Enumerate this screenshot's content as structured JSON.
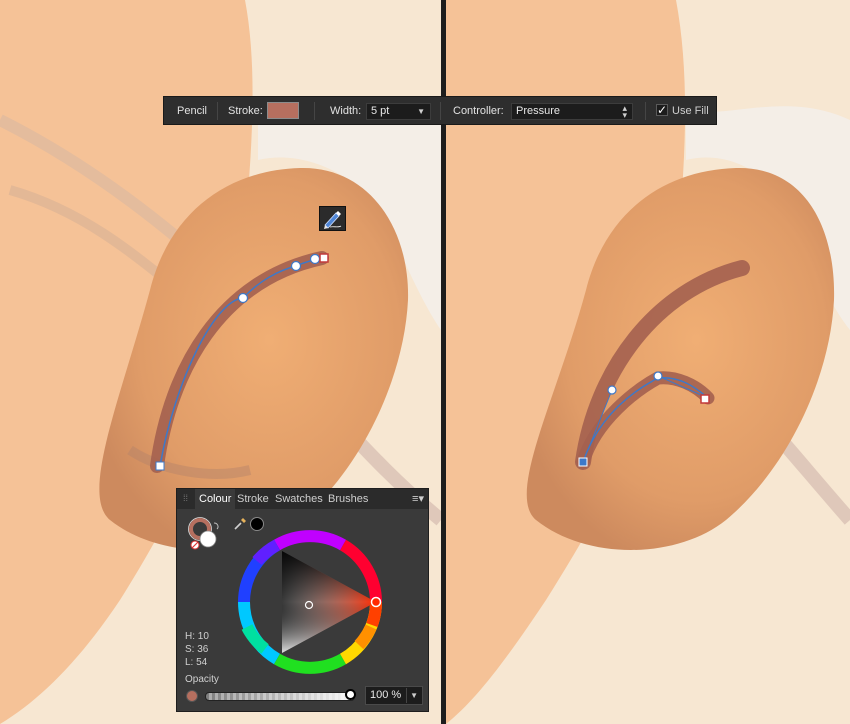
{
  "toolbar": {
    "tool_name": "Pencil",
    "stroke_label": "Stroke:",
    "stroke_color": "#b66f5f",
    "width_label": "Width:",
    "width_value": "5 pt",
    "controller_label": "Controller:",
    "controller_value": "Pressure",
    "use_fill_label": "Use Fill",
    "use_fill_checked": true
  },
  "colour_panel": {
    "tabs": [
      "Colour",
      "Stroke",
      "Swatches",
      "Brushes"
    ],
    "active_tab": "Colour",
    "hsl": {
      "h": "H: 10",
      "s": "S: 36",
      "l": "L: 54"
    },
    "opacity_label": "Opacity",
    "opacity_value": "100 %",
    "opacity_fraction": 1.0
  },
  "colors": {
    "stroke": "#b66f5f",
    "skin": "#f1b98a",
    "ear": "#e6a06a",
    "path_line": "#3d79c9",
    "ui_dark": "#2e2e2e"
  },
  "icons": {
    "tool_cursor": "pencil-icon",
    "recolour": "swap-arrows-icon",
    "picker": "eyedropper-icon",
    "panel_menu": "hamburger-menu-icon"
  }
}
